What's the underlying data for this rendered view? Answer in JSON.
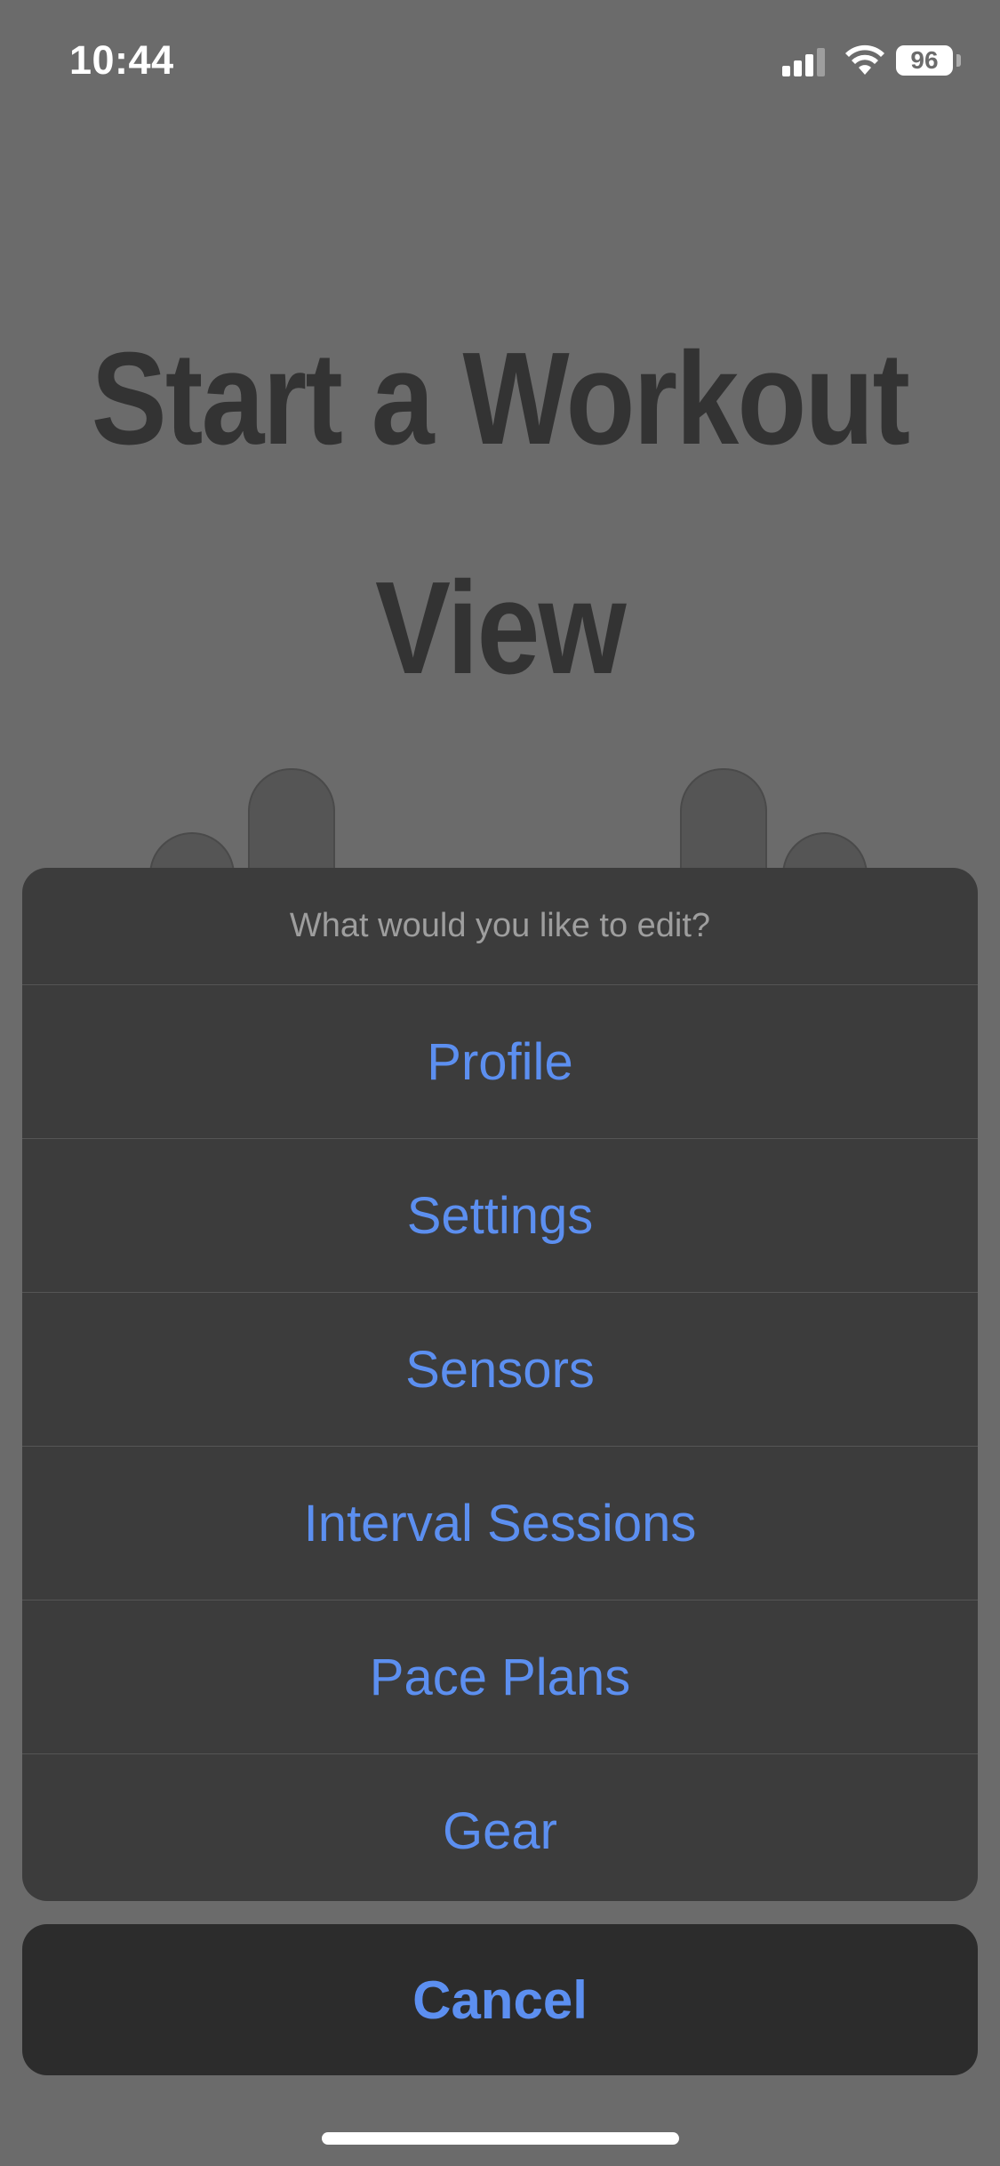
{
  "status_bar": {
    "time": "10:44",
    "battery": "96",
    "icons": [
      "cellular-signal-icon",
      "wifi-icon",
      "battery-icon"
    ]
  },
  "background": {
    "title_line1": "Start a Workout",
    "title_line2": "View"
  },
  "action_sheet": {
    "header": "What would you like to edit?",
    "options": [
      {
        "label": "Profile"
      },
      {
        "label": "Settings"
      },
      {
        "label": "Sensors"
      },
      {
        "label": "Interval Sessions"
      },
      {
        "label": "Pace Plans"
      },
      {
        "label": "Gear"
      }
    ],
    "cancel_label": "Cancel"
  },
  "colors": {
    "accent": "#5c8ff0",
    "overlay": "#6b6b6b",
    "sheet": "#3c3c3c",
    "cancel_bg": "#2c2c2c"
  }
}
